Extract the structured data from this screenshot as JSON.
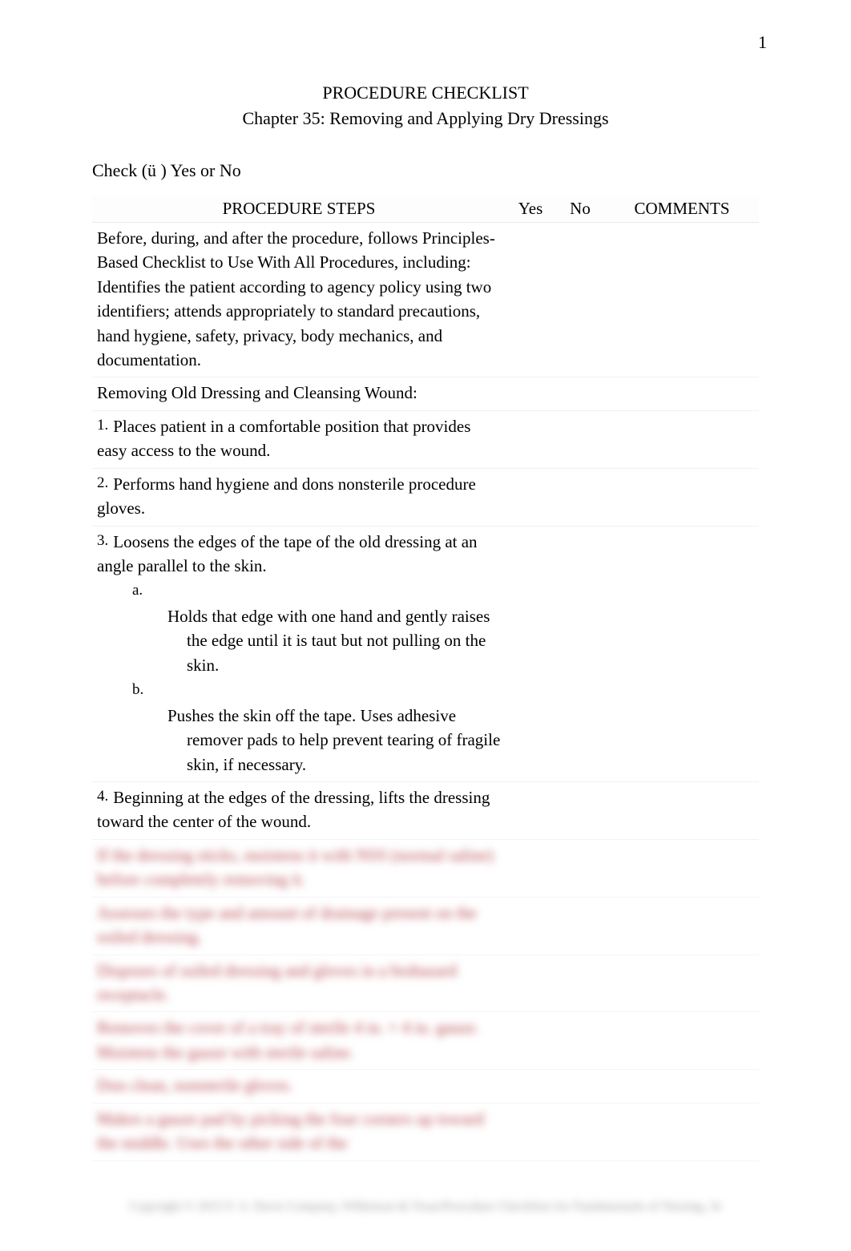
{
  "page_number": "1",
  "title_line1": "PROCEDURE CHECKLIST",
  "title_line2": "Chapter 35: Removing and Applying Dry Dressings",
  "check_line": "Check (ü ) Yes or No",
  "headers": {
    "procedure": "PROCEDURE STEPS",
    "yes": "Yes",
    "no": "No",
    "comments": "COMMENTS"
  },
  "intro_row": "Before, during, and after the procedure, follows Principles-Based Checklist to Use With All Procedures, including: Identifies the patient according to agency policy using two identifiers; attends appropriately to standard precautions, hand hygiene, safety, privacy, body mechanics, and documentation.",
  "section_row": "Removing Old Dressing and Cleansing Wound:",
  "steps": {
    "s1": {
      "num": "1.",
      "text": "Places patient in a comfortable position that provides easy access to the wound."
    },
    "s2": {
      "num": "2.",
      "text": "Performs hand hygiene and dons nonsterile procedure gloves."
    },
    "s3": {
      "num": "3.",
      "text": "Loosens the edges of the tape of the old dressing at an angle parallel to the skin.",
      "a": {
        "letter": "a.",
        "text": "Holds that edge with one hand and gently raises the edge until it is taut but not pulling on the skin."
      },
      "b": {
        "letter": "b.",
        "text": "Pushes the skin off the tape. Uses adhesive remover pads to help prevent tearing of fragile skin, if necessary."
      }
    },
    "s4": {
      "num": "4.",
      "text": "Beginning at the edges of the dressing, lifts the dressing toward the center of the wound."
    }
  },
  "blurred_rows": [
    "If the dressing sticks, moistens it with NSS (normal saline) before completely removing it.",
    "Assesses the type and amount of drainage present on the soiled dressing.",
    "Disposes of soiled dressing and gloves in a biohazard receptacle.",
    "Removes the cover of a tray of sterile 4 in. × 4 in. gauze. Moistens the gauze with sterile saline.",
    "Don clean, nonsterile gloves.",
    "Makes a gauze pad by picking the four corners up toward the middle. Uses the other side of the"
  ],
  "footer": "Copyright © 2015 F. A. Davis Company, Wilkinson & Treas/Procedure Checklists for Fundamentals of Nursing, 3e"
}
